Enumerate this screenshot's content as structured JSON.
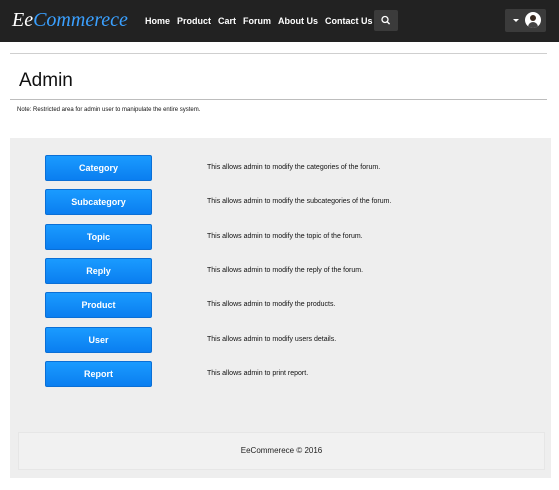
{
  "brand": {
    "part1": "Ee",
    "part2": "Commerece"
  },
  "nav": {
    "items": [
      "Home",
      "Product",
      "Cart",
      "Forum",
      "About Us",
      "Contact Us"
    ]
  },
  "icons": {
    "search": "search-icon",
    "caret": "caret-down-icon",
    "avatar": "user-avatar"
  },
  "page": {
    "title": "Admin",
    "note": "Note: Restricted area for admin user to manipulate the entire system."
  },
  "admin_items": [
    {
      "label": "Category",
      "description": "This allows admin to modify the categories of the forum."
    },
    {
      "label": "Subcategory",
      "description": "This allows admin to modify the subcategories of the forum."
    },
    {
      "label": "Topic",
      "description": "This allows admin to modify the topic of the forum."
    },
    {
      "label": "Reply",
      "description": "This allows admin to modify the reply of the forum."
    },
    {
      "label": "Product",
      "description": "This allows admin to modify the products."
    },
    {
      "label": "User",
      "description": "This allows admin to modify users details."
    },
    {
      "label": "Report",
      "description": "This allows admin to print report."
    }
  ],
  "footer": {
    "text": "EeCommerece © 2016"
  },
  "colors": {
    "navbar": "#222222",
    "brand_accent": "#3aa0ff",
    "button": "#0a7ef0",
    "panel": "#eeeeee"
  }
}
